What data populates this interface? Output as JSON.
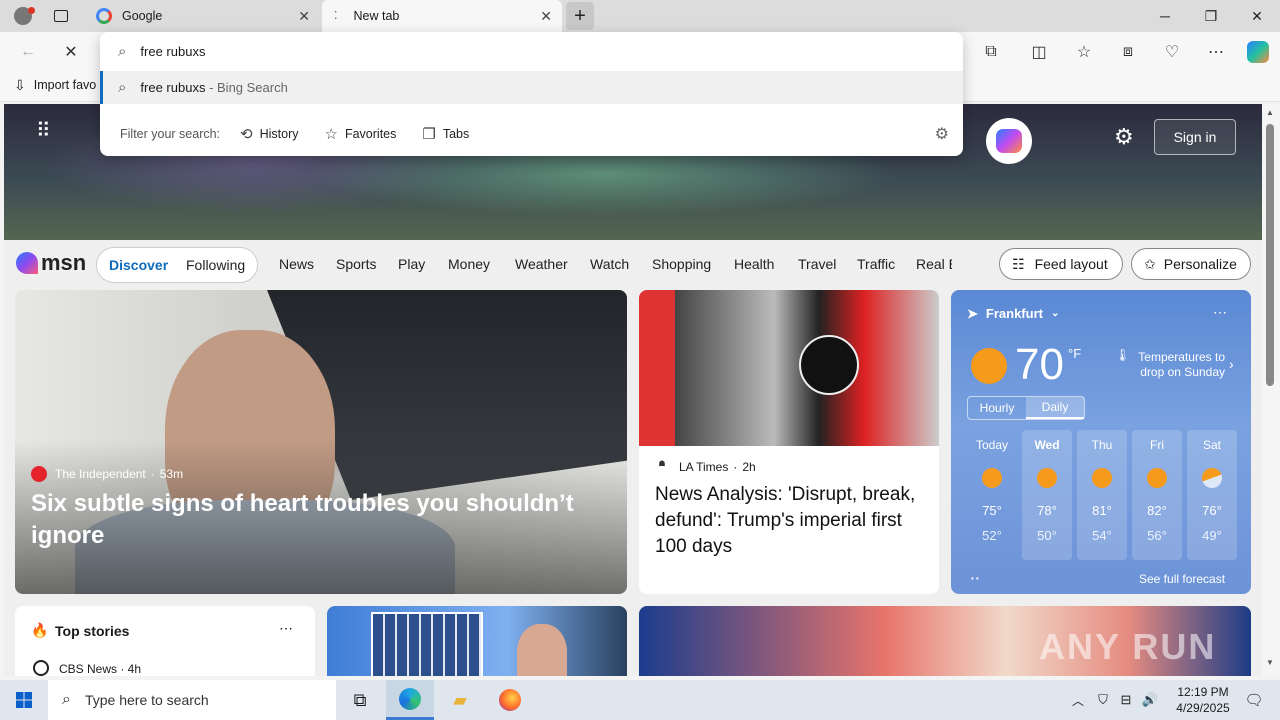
{
  "tabs": [
    {
      "title": "Google",
      "icon": "google-icon"
    },
    {
      "title": "New tab",
      "icon": "loading-icon"
    }
  ],
  "omnibox": {
    "query": "free rubuxs",
    "suggestion_text": "free rubuxs",
    "suggestion_source": " - Bing Search",
    "filter_label": "Filter your search:",
    "filters": [
      "History",
      "Favorites",
      "Tabs"
    ]
  },
  "favbar": {
    "import_label": "Import favo"
  },
  "header": {
    "sign_in": "Sign in"
  },
  "msn": {
    "logo": "msn",
    "feed_tabs": [
      "Discover",
      "Following"
    ],
    "categories": [
      "News",
      "Sports",
      "Play",
      "Money",
      "Weather",
      "Watch",
      "Shopping",
      "Health",
      "Travel",
      "Traffic",
      "Real E"
    ],
    "feed_layout": "Feed layout",
    "personalize": "Personalize"
  },
  "main_story": {
    "source": "The Independent",
    "age": "53m",
    "headline": "Six subtle signs of heart troubles you shouldn’t ignore"
  },
  "la_story": {
    "source": "LA Times",
    "age": "2h",
    "headline": "News Analysis: 'Disrupt, break, defund': Trump's imperial first 100 days"
  },
  "weather": {
    "location": "Frankfurt",
    "temp": "70",
    "unit": "°F",
    "alert": "Temperatures to drop on Sunday",
    "modes": [
      "Hourly",
      "Daily"
    ],
    "days": [
      {
        "day": "Today",
        "hi": "75°",
        "lo": "52°"
      },
      {
        "day": "Wed",
        "hi": "78°",
        "lo": "50°"
      },
      {
        "day": "Thu",
        "hi": "81°",
        "lo": "54°"
      },
      {
        "day": "Fri",
        "hi": "82°",
        "lo": "56°"
      },
      {
        "day": "Sat",
        "hi": "76°",
        "lo": "49°"
      }
    ],
    "full_forecast": "See full forecast"
  },
  "top_stories": {
    "title": "Top stories",
    "first_source": "CBS News · 4h"
  },
  "taskbar": {
    "search_placeholder": "Type here to search",
    "time": "12:19 PM",
    "date": "4/29/2025"
  },
  "watermark": "ANY RUN",
  "colors": {
    "accent": "#0f6cbd",
    "weather_bg": "#6d93d8"
  }
}
